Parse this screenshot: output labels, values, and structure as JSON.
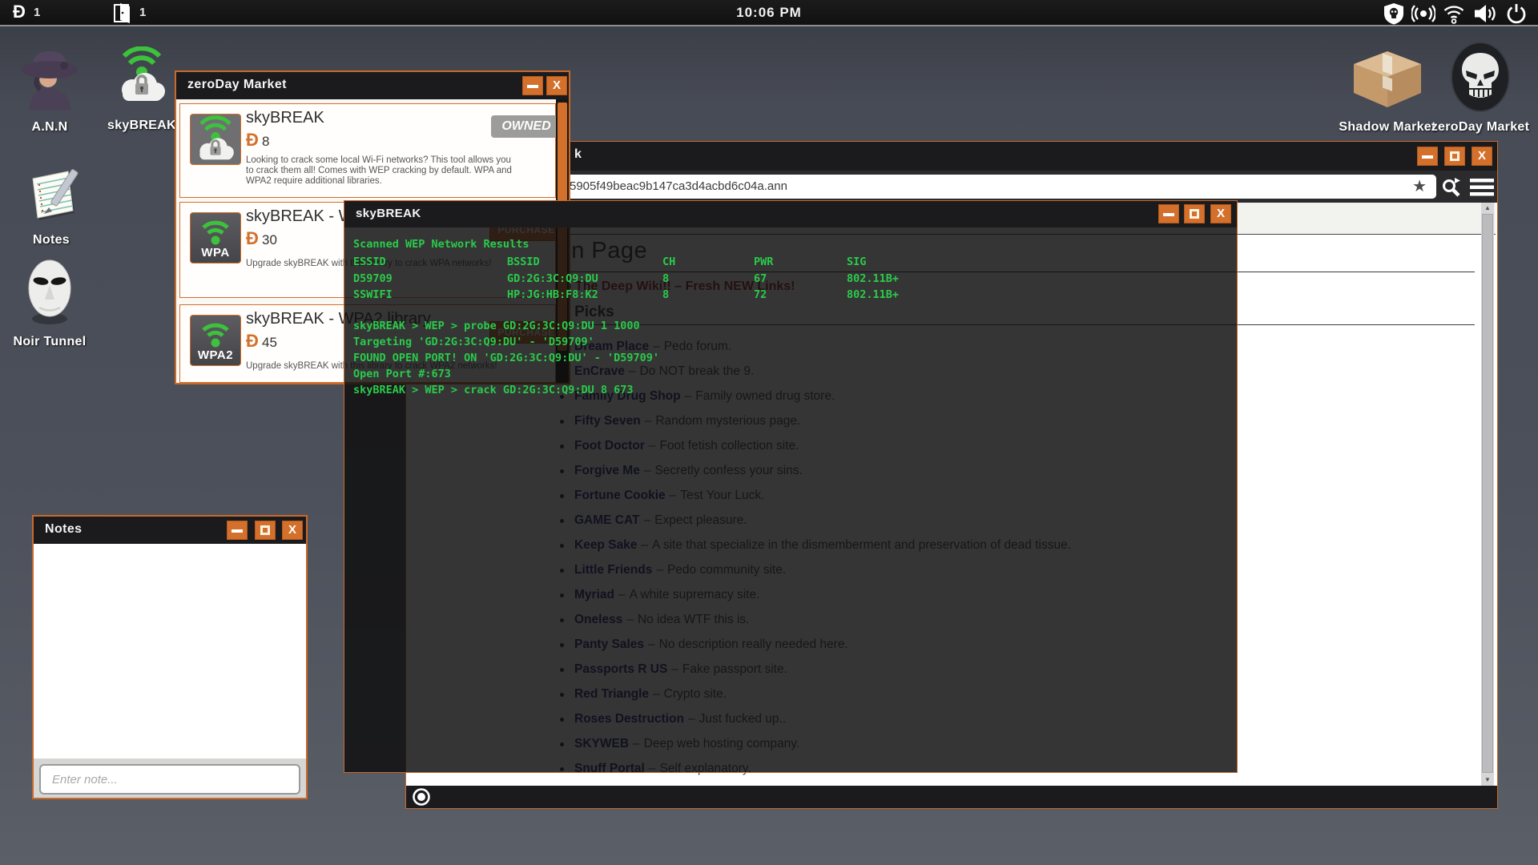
{
  "topbar": {
    "coin_count": "1",
    "door_count": "1",
    "clock": "10:06 PM"
  },
  "desktop_icons": {
    "ann": "A.N.N",
    "skybreak": "skyBREAK",
    "notes": "Notes",
    "noir_tunnel": "Noir Tunnel",
    "shadow_market": "Shadow Market",
    "zeroday_market": "zeroDay Market"
  },
  "market_window": {
    "title": "zeroDay Market",
    "currency_symbol": "Ð",
    "items": [
      {
        "name": "skyBREAK",
        "price": "8",
        "desc": "Looking to crack some local Wi-Fi networks? This tool allows you to crack them all! Comes with WEP cracking by default. WPA and WPA2 require additional libraries.",
        "badge": "OWNED",
        "icon_label": ""
      },
      {
        "name": "skyBREAK - WPA library",
        "price": "30",
        "desc": "Upgrade skyBREAK with this library to crack WPA networks!",
        "button": "PURCHASE",
        "icon_label": "WPA"
      },
      {
        "name": "skyBREAK - WPA2 library",
        "price": "45",
        "desc": "Upgrade skyBREAK with this library to crack WPA2 networks!",
        "button": "PURCHASE",
        "icon_label": "WPA2"
      }
    ]
  },
  "terminal": {
    "title": "skyBREAK",
    "scan_header": "Scanned WEP Network Results",
    "columns": [
      "ESSID",
      "BSSID",
      "CH",
      "PWR",
      "SIG"
    ],
    "networks": [
      {
        "essid": "D59709",
        "bssid": "GD:2G:3C:Q9:DU",
        "ch": "8",
        "pwr": "67",
        "sig": "802.11B+"
      },
      {
        "essid": "SSWIFI",
        "bssid": "HP:JG:HB:F8:K2",
        "ch": "8",
        "pwr": "72",
        "sig": "802.11B+"
      }
    ],
    "lines": [
      "skyBREAK > WEP > probe GD:2G:3C:Q9:DU 1 1000",
      "Targeting 'GD:2G:3C:Q9:DU' - 'D59709'",
      "FOUND OPEN PORT! ON 'GD:2G:3C:Q9:DU' - 'D59709'",
      "Open Port #:673",
      "skyBREAK > WEP > crack GD:2G:3C:Q9:DU 8 673"
    ]
  },
  "browser": {
    "title_visible": "k",
    "url": "5905f49beac9b147ca3d4acbd6c04a.ann",
    "page": {
      "heading": "Main Page",
      "welcome": "Welcome to The Deep Wiki!! – Fresh NEW Links!",
      "section": "Quick Picks",
      "separator": "–",
      "links": [
        {
          "name": "Dream Place",
          "desc": "Pedo forum."
        },
        {
          "name": "EnCrave",
          "desc": "Do NOT break the 9."
        },
        {
          "name": "Family Drug Shop",
          "desc": "Family owned drug store."
        },
        {
          "name": "Fifty Seven",
          "desc": "Random mysterious page."
        },
        {
          "name": "Foot Doctor",
          "desc": "Foot fetish collection site."
        },
        {
          "name": "Forgive Me",
          "desc": "Secretly confess your sins."
        },
        {
          "name": "Fortune Cookie",
          "desc": "Test Your Luck."
        },
        {
          "name": "GAME CAT",
          "desc": "Expect pleasure."
        },
        {
          "name": "Keep Sake",
          "desc": "A site that specialize in the dismemberment and preservation of dead tissue."
        },
        {
          "name": "Little Friends",
          "desc": "Pedo community site."
        },
        {
          "name": "Myriad",
          "desc": "A white supremacy site."
        },
        {
          "name": "Oneless",
          "desc": "No idea WTF this is."
        },
        {
          "name": "Panty Sales",
          "desc": "No description really needed here."
        },
        {
          "name": "Passports R US",
          "desc": "Fake passport site."
        },
        {
          "name": "Red Triangle",
          "desc": "Crypto site."
        },
        {
          "name": "Roses Destruction",
          "desc": "Just fucked up.."
        },
        {
          "name": "SKYWEB",
          "desc": "Deep web hosting company."
        },
        {
          "name": "Snuff Portal",
          "desc": "Self explanatory."
        }
      ]
    }
  },
  "notes_window": {
    "title": "Notes",
    "placeholder": "Enter note..."
  }
}
